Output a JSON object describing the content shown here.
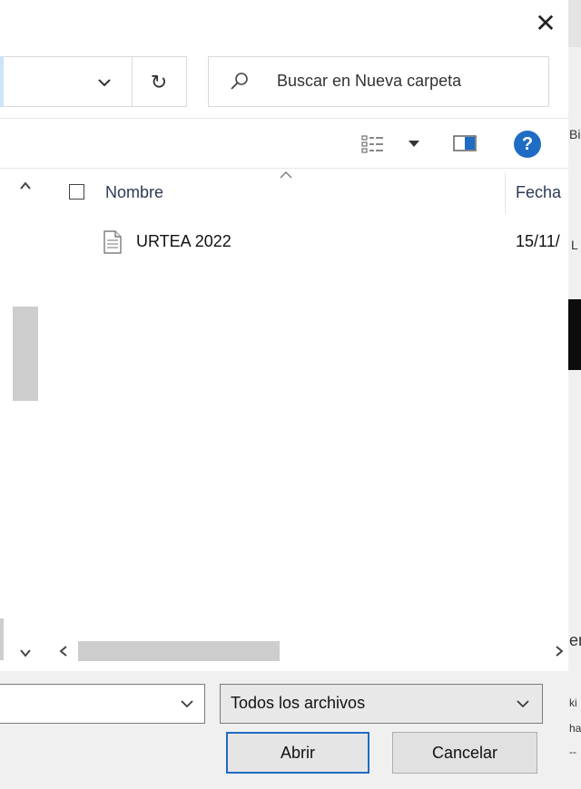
{
  "dialog": {
    "close_glyph": "✕"
  },
  "address": {
    "refresh_glyph": "↻"
  },
  "search": {
    "placeholder": "Buscar en Nueva carpeta"
  },
  "toolbar": {
    "help_glyph": "?"
  },
  "file_list": {
    "columns": [
      "Nombre",
      "Fecha"
    ],
    "rows": [
      {
        "name": "URTEA 2022",
        "date": "15/11/"
      }
    ]
  },
  "footer": {
    "file_type_filter": "Todos los archivos",
    "open_label": "Abrir",
    "cancel_label": "Cancelar"
  },
  "background_window": {
    "texts": [
      "Bi",
      "L",
      "en",
      "ki",
      "ha",
      "--"
    ]
  },
  "icons": {
    "close": "close-icon",
    "address_dropdown": "chevron-down-icon",
    "refresh": "refresh-icon",
    "search": "search-icon",
    "view": "details-view-icon",
    "view_dropdown": "caret-down-icon",
    "preview": "preview-pane-icon",
    "help": "help-icon",
    "file": "text-file-icon"
  },
  "colors": {
    "accent": "#1f6cc4",
    "thumb": "#cdcdcd"
  }
}
